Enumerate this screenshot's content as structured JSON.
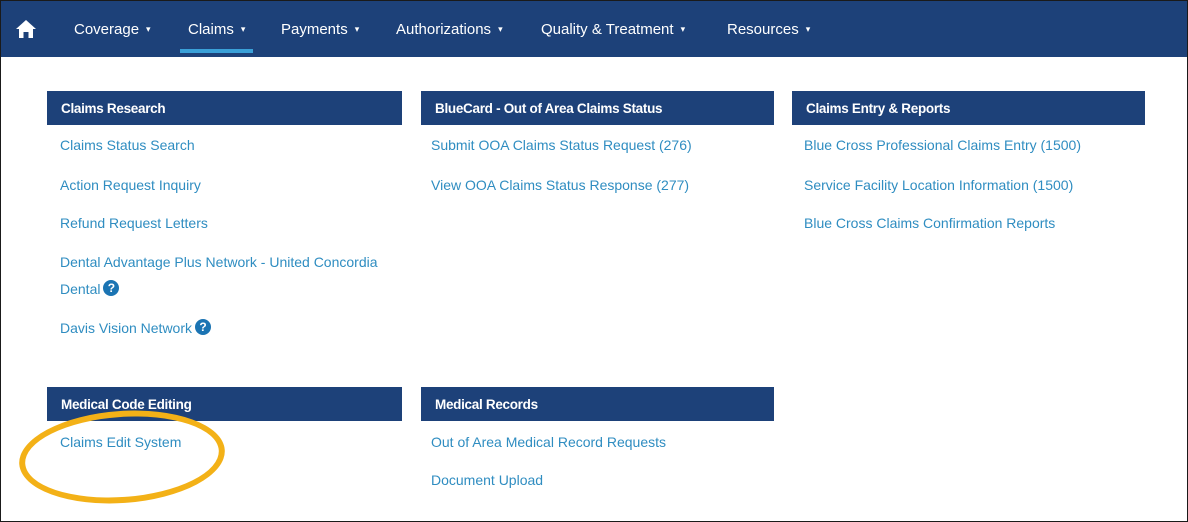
{
  "nav": {
    "items": [
      {
        "label": "Coverage"
      },
      {
        "label": "Claims"
      },
      {
        "label": "Payments"
      },
      {
        "label": "Authorizations"
      },
      {
        "label": "Quality & Treatment"
      },
      {
        "label": "Resources"
      }
    ],
    "caret": "▾",
    "active": "Claims"
  },
  "sections": {
    "claims_research": {
      "title": "Claims Research",
      "links": [
        "Claims Status Search",
        "Action Request Inquiry",
        "Refund Request Letters",
        "Dental Advantage Plus Network - United Concordia",
        "Dental",
        "Davis Vision Network"
      ]
    },
    "bluecard": {
      "title": "BlueCard - Out of Area Claims Status",
      "links": [
        "Submit OOA Claims Status Request (276)",
        "View OOA Claims Status Response (277)"
      ]
    },
    "claims_entry": {
      "title": "Claims Entry & Reports",
      "links": [
        "Blue Cross Professional Claims Entry (1500)",
        "Service Facility Location Information (1500)",
        "Blue Cross Claims Confirmation Reports"
      ]
    },
    "medical_code_editing": {
      "title": "Medical Code Editing",
      "links": [
        "Claims Edit System"
      ]
    },
    "medical_records": {
      "title": "Medical Records",
      "links": [
        "Out of Area Medical Record Requests",
        "Document Upload"
      ]
    }
  },
  "help_icon": "?",
  "colors": {
    "navbar": "#1d4179",
    "active_underline": "#3aa0d8",
    "link": "#2f8dc1",
    "highlight": "#f3b117"
  }
}
